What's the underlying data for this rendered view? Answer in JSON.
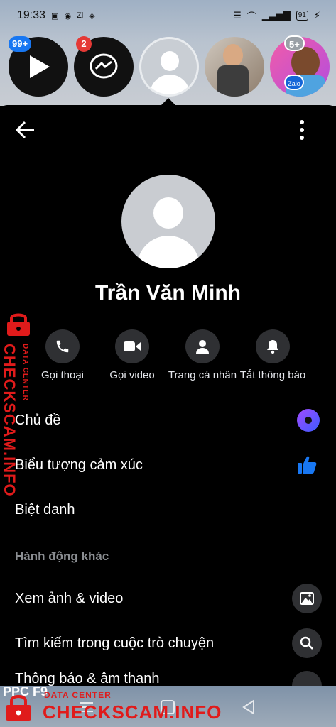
{
  "status_bar": {
    "time": "19:33",
    "battery": "91",
    "notif_icons": [
      "bag-icon",
      "messenger-icon",
      "zalo-icon",
      "layers-icon"
    ]
  },
  "chat_heads": {
    "badge_1": "99+",
    "badge_2": "2",
    "badge_5": "5+",
    "zalo_label": "Zalo"
  },
  "profile": {
    "name": "Trần Văn Minh"
  },
  "actions": [
    {
      "label": "Gọi thoại",
      "icon": "phone-icon"
    },
    {
      "label": "Gọi video",
      "icon": "video-icon"
    },
    {
      "label": "Trang cá nhân",
      "icon": "person-icon"
    },
    {
      "label": "Tắt thông báo",
      "icon": "bell-icon"
    }
  ],
  "settings": {
    "theme": "Chủ đề",
    "emoji": "Biểu tượng cảm xúc",
    "nickname": "Biệt danh",
    "section_other": "Hành động khác",
    "media": "Xem ảnh & video",
    "search": "Tìm kiếm trong cuộc trò chuyện",
    "notifications": "Thông báo & âm thanh"
  },
  "watermark": {
    "brand": "CHECKSCAM.INFO",
    "sub": "DATA CENTER",
    "ppc": "PPC F9"
  },
  "colors": {
    "accent_theme": "#7b4dff",
    "like_blue": "#1877f2",
    "watermark_red": "#e01b1b"
  }
}
